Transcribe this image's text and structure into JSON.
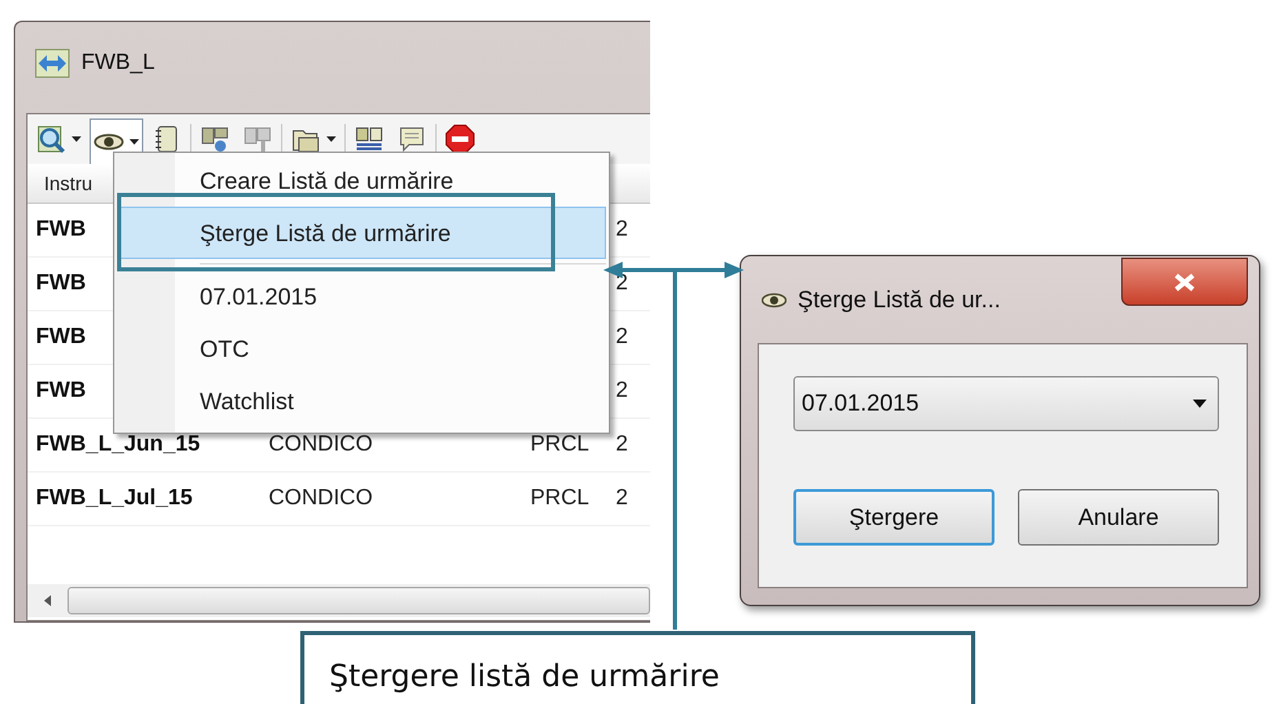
{
  "main_window": {
    "title": "FWB_L",
    "toolbar": [
      {
        "kind": "magnifier",
        "dropdown": true,
        "pressed": false
      },
      {
        "kind": "eye",
        "dropdown": true,
        "pressed": true
      },
      {
        "kind": "notebook",
        "dropdown": false,
        "pressed": false
      },
      {
        "kind": "windows",
        "dropdown": false,
        "pressed": false
      },
      {
        "kind": "windows-grey",
        "dropdown": false,
        "pressed": false
      },
      {
        "kind": "folders",
        "dropdown": true,
        "pressed": false
      },
      {
        "kind": "layout",
        "dropdown": false,
        "pressed": false
      },
      {
        "kind": "speech",
        "dropdown": false,
        "pressed": false
      },
      {
        "kind": "stop",
        "dropdown": false,
        "pressed": false
      }
    ],
    "table": {
      "columns": [
        {
          "label": "Instru"
        }
      ],
      "rows": [
        {
          "column_1": "FWB",
          "column_4": "2"
        },
        {
          "column_1": "FWB",
          "column_4": "2"
        },
        {
          "column_1": "FWB",
          "column_4": "2"
        },
        {
          "column_1": "FWB",
          "column_4": "2"
        },
        {
          "column_1": "FWB_L_Jun_15",
          "column_2": "CONDICO",
          "column_3": "PRCL",
          "column_4": "2"
        },
        {
          "column_1": "FWB_L_Jul_15",
          "column_2": "CONDICO",
          "column_3": "PRCL",
          "column_4": "2"
        }
      ]
    }
  },
  "menu": {
    "items": [
      {
        "kind": "item",
        "label": "Creare Listă de urmărire",
        "selected": false
      },
      {
        "kind": "item",
        "label": "Şterge Listă de urmărire",
        "selected": true
      },
      {
        "kind": "separator"
      },
      {
        "kind": "item",
        "label": "07.01.2015",
        "selected": false
      },
      {
        "kind": "item",
        "label": "OTC",
        "selected": false
      },
      {
        "kind": "item",
        "label": "Watchlist",
        "selected": false
      }
    ]
  },
  "dialog": {
    "title": "Şterge Listă de ur...",
    "select": {
      "value": "07.01.2015"
    },
    "buttons": [
      {
        "label": "Ştergere",
        "focused": true
      },
      {
        "label": "Anulare",
        "focused": false
      }
    ]
  },
  "callout": {
    "text": "Ştergere listă de urmărire"
  }
}
